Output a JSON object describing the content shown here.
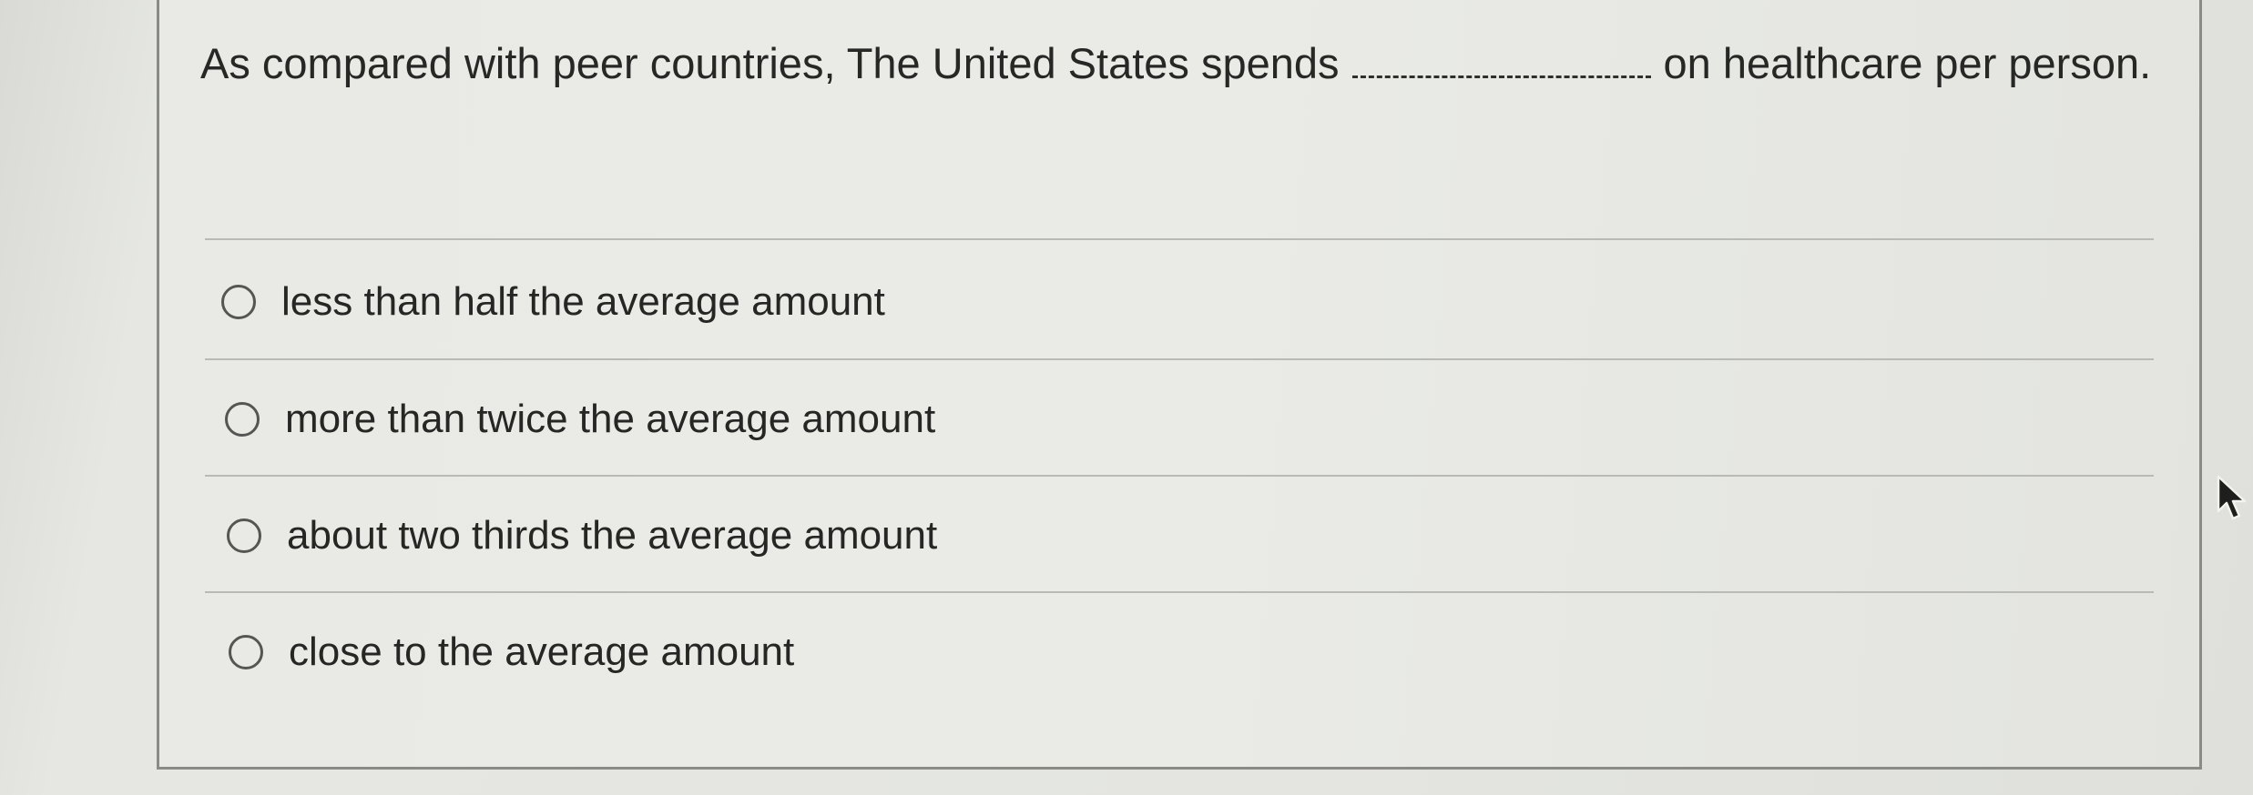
{
  "question": {
    "text_before": "As compared with peer countries, The United States spends",
    "text_after": "on healthcare per person."
  },
  "options": [
    {
      "label": "less than half the average amount",
      "selected": false
    },
    {
      "label": "more than twice the average amount",
      "selected": false
    },
    {
      "label": "about two thirds the average amount",
      "selected": false
    },
    {
      "label": "close to the average amount",
      "selected": false
    }
  ],
  "icons": {
    "cursor": "mouse-pointer-icon"
  }
}
